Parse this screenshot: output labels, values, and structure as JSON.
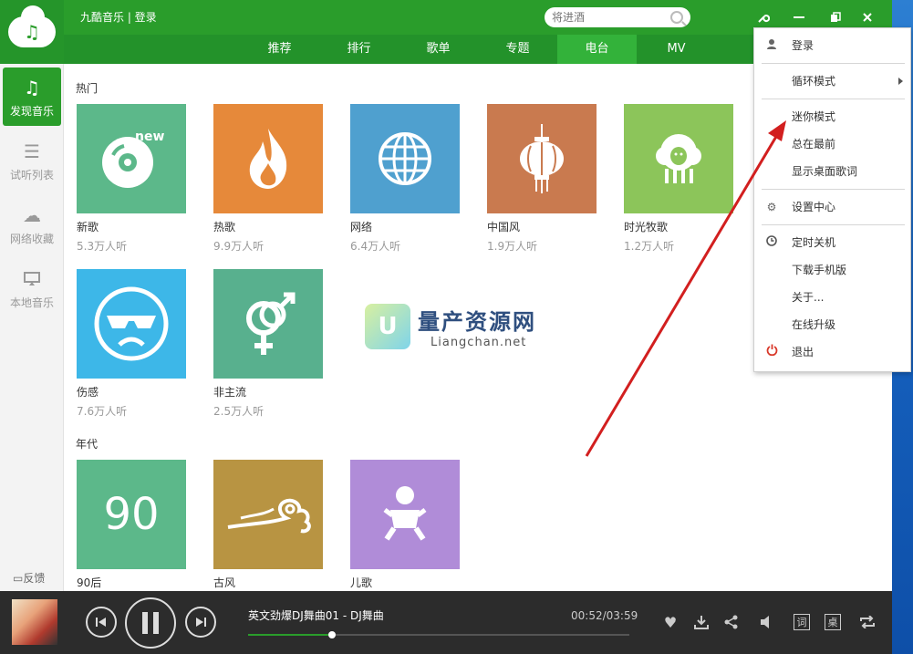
{
  "app": {
    "title": "九酷音乐 | 登录",
    "search_placeholder": "将进酒"
  },
  "tabs": [
    {
      "label": "推荐"
    },
    {
      "label": "排行"
    },
    {
      "label": "歌单"
    },
    {
      "label": "专题"
    },
    {
      "label": "电台",
      "active": true
    },
    {
      "label": "MV"
    }
  ],
  "sidebar": {
    "items": [
      {
        "label": "发现音乐",
        "icon": "music-note-icon",
        "active": true
      },
      {
        "label": "试听列表",
        "icon": "list-icon"
      },
      {
        "label": "网络收藏",
        "icon": "cloud-icon"
      },
      {
        "label": "本地音乐",
        "icon": "monitor-icon"
      }
    ],
    "feedback": "反馈"
  },
  "sections": {
    "hot": {
      "title": "热门",
      "cards": [
        {
          "name": "新歌",
          "listen": "5.3万人听",
          "color": "#5cb88a",
          "icon": "cd-new-icon"
        },
        {
          "name": "热歌",
          "listen": "9.9万人听",
          "color": "#e6893a",
          "icon": "fire-icon"
        },
        {
          "name": "网络",
          "listen": "6.4万人听",
          "color": "#4fa0cf",
          "icon": "globe-icon"
        },
        {
          "name": "中国风",
          "listen": "1.9万人听",
          "color": "#c97a4f",
          "icon": "lantern-icon"
        },
        {
          "name": "时光牧歌",
          "listen": "1.2万人听",
          "color": "#8cc55a",
          "icon": "sheep-icon"
        },
        {
          "name": "伤感",
          "listen": "7.6万人听",
          "color": "#3db7e8",
          "icon": "sad-face-icon"
        },
        {
          "name": "非主流",
          "listen": "2.5万人听",
          "color": "#58b08e",
          "icon": "gender-symbol-icon"
        }
      ]
    },
    "era": {
      "title": "年代",
      "cards": [
        {
          "name": "90后",
          "color": "#5cb88a",
          "icon": "ninety-icon",
          "tile_text": "90"
        },
        {
          "name": "古风",
          "color": "#b89442",
          "icon": "cloud-swirl-icon"
        },
        {
          "name": "儿歌",
          "color": "#b08cd8",
          "icon": "baby-icon"
        }
      ]
    }
  },
  "watermark": {
    "logo": "U",
    "main": "量产资源网",
    "sub": "Liangchan.net"
  },
  "player": {
    "song": "英文劲爆DJ舞曲01 - DJ舞曲",
    "time": "00:52/03:59",
    "progress": 0.22,
    "lyrics_label": "词",
    "desktop_label": "桌"
  },
  "menu": {
    "items": [
      {
        "label": "登录",
        "icon": "user-icon"
      },
      {
        "label": "循环模式",
        "submenu": true
      },
      {
        "label": "迷你模式"
      },
      {
        "label": "总在最前"
      },
      {
        "label": "显示桌面歌词"
      },
      {
        "label": "设置中心",
        "icon": "gear-icon"
      },
      {
        "label": "定时关机",
        "icon": "clock-icon"
      },
      {
        "label": "下载手机版"
      },
      {
        "label": "关于..."
      },
      {
        "label": "在线升级"
      },
      {
        "label": "退出",
        "icon": "power-icon"
      }
    ]
  },
  "colors": {
    "brand_green": "#2a9d2b",
    "arrow_red": "#d21f1f",
    "player_bg": "#2c2c2c"
  }
}
